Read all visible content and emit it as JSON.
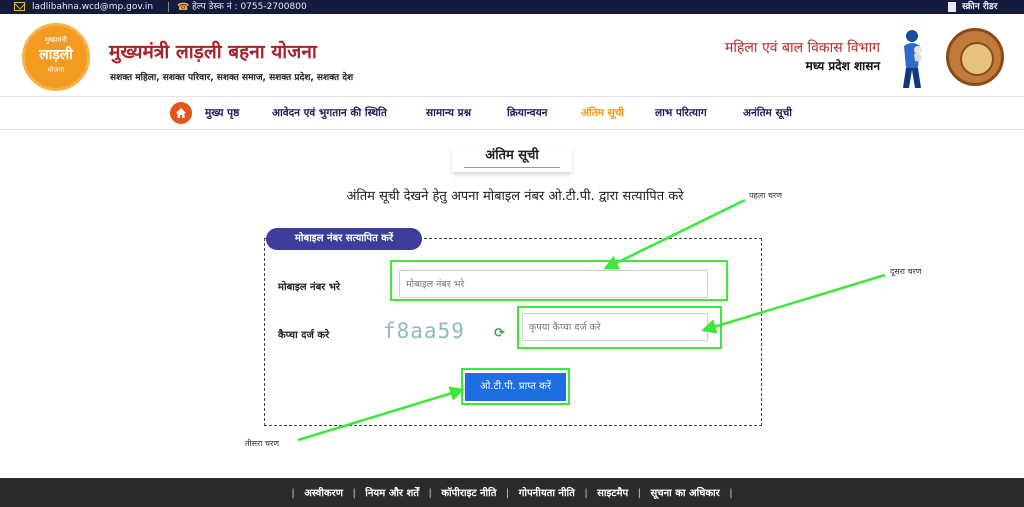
{
  "topbar": {
    "email": "ladlibahna.wcd@mp.gov.in",
    "helpdesk": "हेल्प डेस्क नं : 0755-2700800",
    "screen_reader": "स्क्रीन रीडर"
  },
  "header": {
    "logo_text_top": "मुख्यमंत्री",
    "logo_text_main": "लाड़ली",
    "logo_text_bottom": "योजना",
    "title": "मुख्यमंत्री लाड़ली बहना योजना",
    "tagline": "सशक्त महिला, सशक्त परिवार, सशक्त समाज, सशक्त प्रदेश, सशक्त देश",
    "department": "महिला एवं बाल विकास विभाग",
    "state": "मध्य प्रदेश शासन"
  },
  "nav": {
    "items": [
      {
        "label": "मुख्य पृष्ठ"
      },
      {
        "label": "आवेदन एवं भुगतान की स्थिति"
      },
      {
        "label": "सामान्य प्रश्न"
      },
      {
        "label": "क्रियान्वयन"
      },
      {
        "label": "अंतिम सूची"
      },
      {
        "label": "लाभ परित्याग"
      },
      {
        "label": "अनंतिम सूची"
      }
    ],
    "active_index": 4
  },
  "main": {
    "section_title": "अंतिम सूची",
    "instruction": "अंतिम सूची देखने हेतु अपना मोबाइल नंबर ओ.टी.पी. द्वारा सत्यापित करे",
    "form": {
      "legend": "मोबाइल नंबर सत्यापित करें",
      "mobile_label": "मोबाइल नंबर भरे",
      "mobile_placeholder": "मोबाइल नंबर भरे",
      "captcha_label": "कैप्चा दर्ज करे",
      "captcha_value": "f8aa59",
      "captcha_placeholder": "कृपया कैप्चा दर्ज करे",
      "otp_button": "ओ.टी.पी. प्राप्त करें"
    }
  },
  "annotations": {
    "step1": "पहला चरण",
    "step2": "दूसरा चरण",
    "step3": "तीसरा चरण",
    "color": "#3ee83a"
  },
  "footer": {
    "links": [
      "अस्वीकरण",
      "नियम और शर्तें",
      "कॉपीराइट नीति",
      "गोपनीयता नीति",
      "साइटमैप",
      "सूचना का अधिकार"
    ]
  }
}
